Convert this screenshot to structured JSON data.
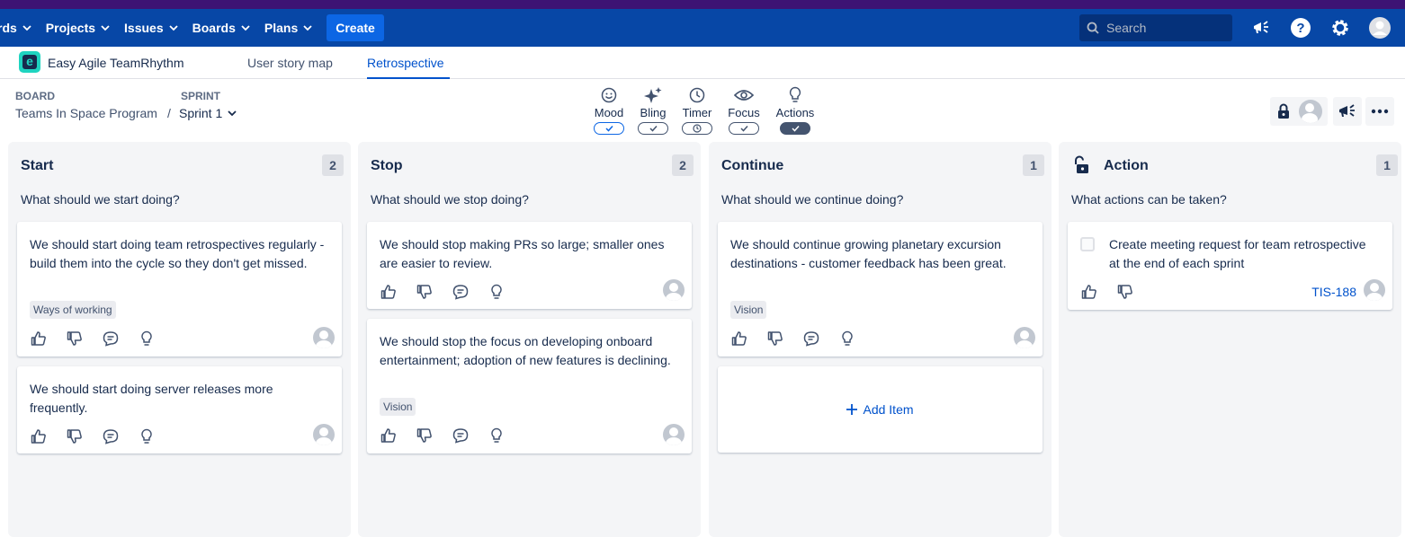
{
  "topnav": {
    "items": [
      {
        "label": "rds"
      },
      {
        "label": "Projects"
      },
      {
        "label": "Issues"
      },
      {
        "label": "Boards"
      },
      {
        "label": "Plans"
      }
    ],
    "create_label": "Create",
    "search_placeholder": "Search",
    "icons": [
      "megaphone-icon",
      "help-icon",
      "settings-icon",
      "profile-avatar"
    ]
  },
  "subnav": {
    "app_name": "Easy Agile TeamRhythm",
    "logo_letter": "e",
    "tabs": [
      {
        "label": "User story map",
        "active": false
      },
      {
        "label": "Retrospective",
        "active": true
      }
    ]
  },
  "breadcrumb": {
    "board_label": "BOARD",
    "board_value": "Teams In Space Program",
    "separator": "/",
    "sprint_label": "SPRINT",
    "sprint_value": "Sprint 1"
  },
  "toolbar": {
    "tools": [
      {
        "label": "Mood",
        "icon": "smile-icon",
        "state": "on"
      },
      {
        "label": "Bling",
        "icon": "sparkle-icon",
        "state": "on"
      },
      {
        "label": "Timer",
        "icon": "clock-icon",
        "state": "timer"
      },
      {
        "label": "Focus",
        "icon": "eye-icon",
        "state": "on"
      },
      {
        "label": "Actions",
        "icon": "lightbulb-icon",
        "state": "active"
      }
    ]
  },
  "colors": {
    "nav_bg": "#0747a6",
    "top_stripe": "#3d1374",
    "accent": "#0052cc",
    "create_btn": "#0c66e4",
    "column_bg": "#f4f5f7"
  },
  "columns": [
    {
      "title": "Start",
      "count": "2",
      "description": "What should we start doing?",
      "cards": [
        {
          "text": "We should start doing team retrospectives regularly - build them into the cycle so they don't get missed.",
          "tag": "Ways of working"
        },
        {
          "text": "We should start doing server releases more frequently.",
          "tag": ""
        }
      ]
    },
    {
      "title": "Stop",
      "count": "2",
      "description": "What should we stop doing?",
      "cards": [
        {
          "text": "We should stop making PRs so large; smaller ones are easier to review.",
          "tag": ""
        },
        {
          "text": "We should stop the focus on developing onboard entertainment; adoption of new features is declining.",
          "tag": "Vision"
        }
      ]
    },
    {
      "title": "Continue",
      "count": "1",
      "description": "What should we continue doing?",
      "cards": [
        {
          "text": "We should continue growing planetary excursion destinations - customer feedback has been great.",
          "tag": "Vision"
        }
      ],
      "add_item_label": "Add Item"
    },
    {
      "title": "Action",
      "count": "1",
      "description": "What actions can be taken?",
      "cards": [
        {
          "text": "Create meeting request for team retrospective at the end of each sprint",
          "issue_key": "TIS-188"
        }
      ]
    }
  ]
}
